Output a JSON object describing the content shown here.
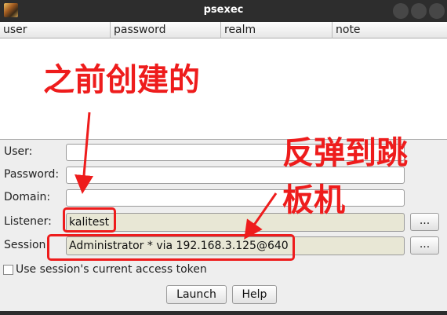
{
  "window": {
    "title": "psexec",
    "icon": "app-logo-icon",
    "controls": [
      "minimize-icon",
      "maximize-icon",
      "close-icon"
    ]
  },
  "table": {
    "columns": [
      "user",
      "password",
      "realm",
      "note"
    ],
    "rows": []
  },
  "form": {
    "user_label": "User:",
    "user_value": "",
    "password_label": "Password:",
    "password_value": "",
    "domain_label": "Domain:",
    "domain_value": "",
    "listener_label": "Listener:",
    "listener_value": "kalitest",
    "listener_button": "...",
    "session_label": "Session",
    "session_value": "Administrator * via  192.168.3.125@640",
    "session_button": "...",
    "token_checkbox_label": "Use session's current access token",
    "token_checked": false
  },
  "buttons": {
    "launch": "Launch",
    "help": "Help"
  },
  "annotations": {
    "note_previous": "之前创建的",
    "note_reverse_line1": "反弹到跳",
    "note_reverse_line2": "板机",
    "color": "#ee1c1c"
  }
}
